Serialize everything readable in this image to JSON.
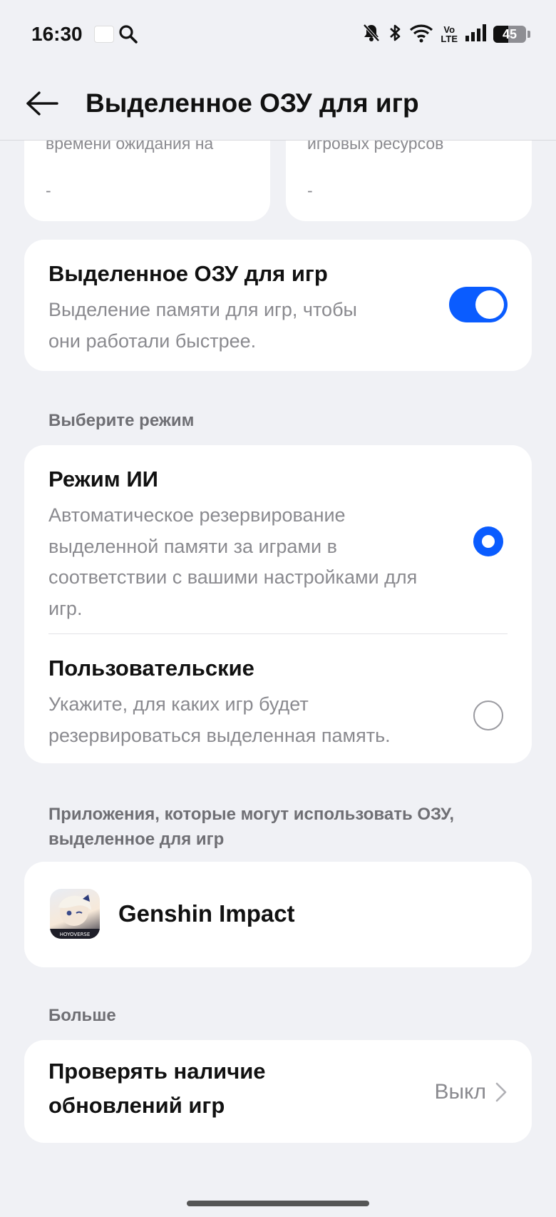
{
  "status_bar": {
    "time": "16:30",
    "battery_level": "45",
    "icons": [
      "mini-app-icon",
      "search-icon",
      "mute-bell-icon",
      "bluetooth-icon",
      "wifi-icon",
      "volte-icon",
      "signal-icon",
      "battery-icon"
    ],
    "volte_top": "Vo",
    "volte_bottom": "LTE"
  },
  "header": {
    "title": "Выделенное ОЗУ для игр"
  },
  "top_cards": [
    {
      "text": "времени ожидания на",
      "value": "-"
    },
    {
      "text": "игровых ресурсов",
      "value": "-"
    }
  ],
  "dedicated_ram": {
    "title": "Выделенное ОЗУ для игр",
    "subtitle_line1": "Выделение памяти для игр, чтобы",
    "subtitle_line2": "они работали быстрее.",
    "enabled": true
  },
  "mode_section": {
    "label": "Выберите режим",
    "options": [
      {
        "title": "Режим ИИ",
        "lines": [
          "Автоматическое резервирование",
          "выделенной памяти за играми в",
          "соответствии с вашими настройками для",
          "игр."
        ],
        "selected": true
      },
      {
        "title": "Пользовательские",
        "lines": [
          "Укажите, для каких игр будет",
          "резервироваться выделенная память."
        ],
        "selected": false
      }
    ]
  },
  "apps_section": {
    "label_line1": "Приложения, которые могут использовать ОЗУ,",
    "label_line2": "выделенное для игр",
    "apps": [
      {
        "name": "Genshin Impact",
        "icon_label": "HOYOVERSE"
      }
    ]
  },
  "more_section": {
    "label": "Больше",
    "item_line1": "Проверять наличие",
    "item_line2": "обновлений игр",
    "item_value": "Выкл"
  },
  "colors": {
    "accent": "#0a5cff",
    "background": "#f0f1f5",
    "card": "#ffffff",
    "secondary_text": "#8a8a8f"
  }
}
